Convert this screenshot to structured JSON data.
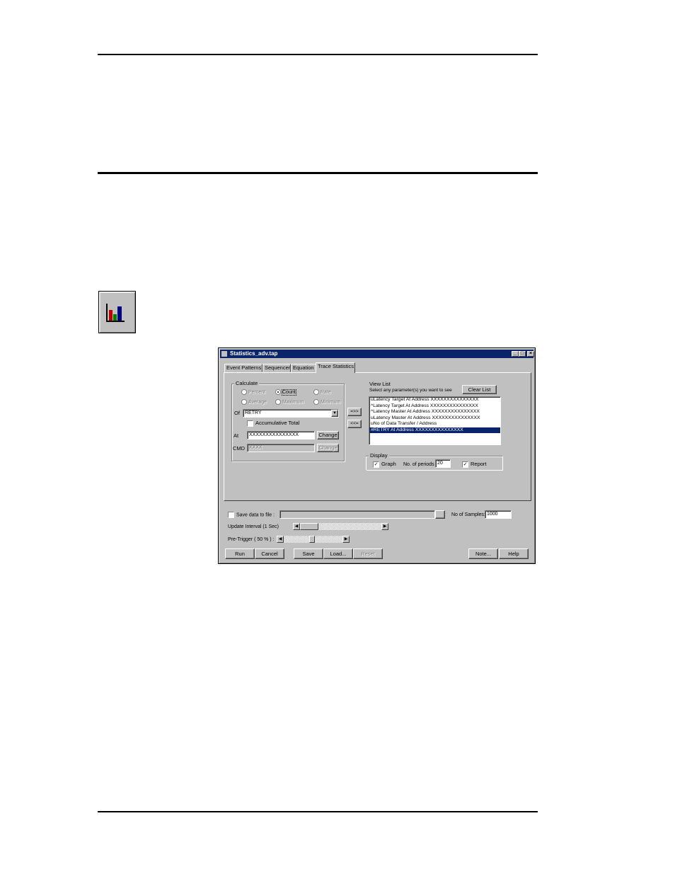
{
  "dialog": {
    "title": "Statistics_adv.tap",
    "tabs": [
      "Event Patterns",
      "Sequencer",
      "Equation",
      "Trace Statistics"
    ],
    "calculate": {
      "label": "Calculate",
      "options": [
        {
          "label": "Percent",
          "selected": false,
          "enabled": false
        },
        {
          "label": "Count",
          "selected": true,
          "enabled": true
        },
        {
          "label": "Rate",
          "selected": false,
          "enabled": false
        },
        {
          "label": "Average",
          "selected": false,
          "enabled": false
        },
        {
          "label": "Maximum",
          "selected": false,
          "enabled": false
        },
        {
          "label": "Minimum",
          "selected": false,
          "enabled": false
        }
      ],
      "of_label": "Of",
      "of_value": "RETRY",
      "accumulative_label": "Accumulative Total",
      "at_label": "At",
      "at_value": "XXXXXXXXXXXXXXX",
      "change_label": "Change",
      "cmd_label": "CMD",
      "cmd_value": "XXXX",
      "cmd_change_label": "Change"
    },
    "add_label": "=>>",
    "remove_label": "<<=",
    "view_list": {
      "label": "View List",
      "hint": "Select any parameter(s) you want to see",
      "clear_label": "Clear List",
      "items": [
        "uLatency Target At Address XXXXXXXXXXXXXXX",
        "^Latency Target At Address XXXXXXXXXXXXXXX",
        "^Latency Master At Address XXXXXXXXXXXXXXX",
        "uLatency Master At Address XXXXXXXXXXXXXXX",
        "uNo of Data Transfer / Address",
        "#RETRY At Address XXXXXXXXXXXXXXX"
      ],
      "selected_index": 5
    },
    "display": {
      "label": "Display",
      "graph_label": "Graph",
      "graph_checked": true,
      "periods_label": "No. of periods",
      "periods_value": "20",
      "report_label": "Report",
      "report_checked": true
    },
    "save_to_file_label": "Save data to file :",
    "samples_label": "No of Samples:",
    "samples_value": "1000",
    "update_label": "Update Interval (1 Sec)",
    "pretrigger_label": "Pre-Trigger ( 50 % ) :",
    "pretrigger_percent": 50,
    "buttons": {
      "run": "Run",
      "cancel": "Cancel",
      "save": "Save",
      "load": "Load...",
      "reset": "Reset",
      "note": "Note...",
      "help": "Help"
    }
  }
}
